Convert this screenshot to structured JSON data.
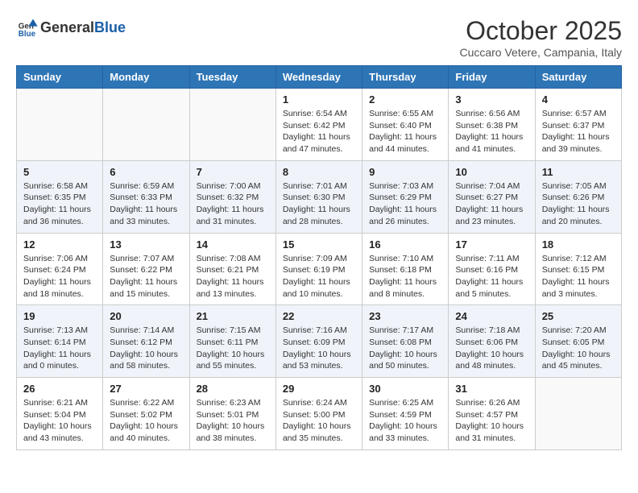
{
  "header": {
    "logo_general": "General",
    "logo_blue": "Blue",
    "month": "October 2025",
    "location": "Cuccaro Vetere, Campania, Italy"
  },
  "weekdays": [
    "Sunday",
    "Monday",
    "Tuesday",
    "Wednesday",
    "Thursday",
    "Friday",
    "Saturday"
  ],
  "weeks": [
    [
      {
        "day": "",
        "info": ""
      },
      {
        "day": "",
        "info": ""
      },
      {
        "day": "",
        "info": ""
      },
      {
        "day": "1",
        "info": "Sunrise: 6:54 AM\nSunset: 6:42 PM\nDaylight: 11 hours\nand 47 minutes."
      },
      {
        "day": "2",
        "info": "Sunrise: 6:55 AM\nSunset: 6:40 PM\nDaylight: 11 hours\nand 44 minutes."
      },
      {
        "day": "3",
        "info": "Sunrise: 6:56 AM\nSunset: 6:38 PM\nDaylight: 11 hours\nand 41 minutes."
      },
      {
        "day": "4",
        "info": "Sunrise: 6:57 AM\nSunset: 6:37 PM\nDaylight: 11 hours\nand 39 minutes."
      }
    ],
    [
      {
        "day": "5",
        "info": "Sunrise: 6:58 AM\nSunset: 6:35 PM\nDaylight: 11 hours\nand 36 minutes."
      },
      {
        "day": "6",
        "info": "Sunrise: 6:59 AM\nSunset: 6:33 PM\nDaylight: 11 hours\nand 33 minutes."
      },
      {
        "day": "7",
        "info": "Sunrise: 7:00 AM\nSunset: 6:32 PM\nDaylight: 11 hours\nand 31 minutes."
      },
      {
        "day": "8",
        "info": "Sunrise: 7:01 AM\nSunset: 6:30 PM\nDaylight: 11 hours\nand 28 minutes."
      },
      {
        "day": "9",
        "info": "Sunrise: 7:03 AM\nSunset: 6:29 PM\nDaylight: 11 hours\nand 26 minutes."
      },
      {
        "day": "10",
        "info": "Sunrise: 7:04 AM\nSunset: 6:27 PM\nDaylight: 11 hours\nand 23 minutes."
      },
      {
        "day": "11",
        "info": "Sunrise: 7:05 AM\nSunset: 6:26 PM\nDaylight: 11 hours\nand 20 minutes."
      }
    ],
    [
      {
        "day": "12",
        "info": "Sunrise: 7:06 AM\nSunset: 6:24 PM\nDaylight: 11 hours\nand 18 minutes."
      },
      {
        "day": "13",
        "info": "Sunrise: 7:07 AM\nSunset: 6:22 PM\nDaylight: 11 hours\nand 15 minutes."
      },
      {
        "day": "14",
        "info": "Sunrise: 7:08 AM\nSunset: 6:21 PM\nDaylight: 11 hours\nand 13 minutes."
      },
      {
        "day": "15",
        "info": "Sunrise: 7:09 AM\nSunset: 6:19 PM\nDaylight: 11 hours\nand 10 minutes."
      },
      {
        "day": "16",
        "info": "Sunrise: 7:10 AM\nSunset: 6:18 PM\nDaylight: 11 hours\nand 8 minutes."
      },
      {
        "day": "17",
        "info": "Sunrise: 7:11 AM\nSunset: 6:16 PM\nDaylight: 11 hours\nand 5 minutes."
      },
      {
        "day": "18",
        "info": "Sunrise: 7:12 AM\nSunset: 6:15 PM\nDaylight: 11 hours\nand 3 minutes."
      }
    ],
    [
      {
        "day": "19",
        "info": "Sunrise: 7:13 AM\nSunset: 6:14 PM\nDaylight: 11 hours\nand 0 minutes."
      },
      {
        "day": "20",
        "info": "Sunrise: 7:14 AM\nSunset: 6:12 PM\nDaylight: 10 hours\nand 58 minutes."
      },
      {
        "day": "21",
        "info": "Sunrise: 7:15 AM\nSunset: 6:11 PM\nDaylight: 10 hours\nand 55 minutes."
      },
      {
        "day": "22",
        "info": "Sunrise: 7:16 AM\nSunset: 6:09 PM\nDaylight: 10 hours\nand 53 minutes."
      },
      {
        "day": "23",
        "info": "Sunrise: 7:17 AM\nSunset: 6:08 PM\nDaylight: 10 hours\nand 50 minutes."
      },
      {
        "day": "24",
        "info": "Sunrise: 7:18 AM\nSunset: 6:06 PM\nDaylight: 10 hours\nand 48 minutes."
      },
      {
        "day": "25",
        "info": "Sunrise: 7:20 AM\nSunset: 6:05 PM\nDaylight: 10 hours\nand 45 minutes."
      }
    ],
    [
      {
        "day": "26",
        "info": "Sunrise: 6:21 AM\nSunset: 5:04 PM\nDaylight: 10 hours\nand 43 minutes."
      },
      {
        "day": "27",
        "info": "Sunrise: 6:22 AM\nSunset: 5:02 PM\nDaylight: 10 hours\nand 40 minutes."
      },
      {
        "day": "28",
        "info": "Sunrise: 6:23 AM\nSunset: 5:01 PM\nDaylight: 10 hours\nand 38 minutes."
      },
      {
        "day": "29",
        "info": "Sunrise: 6:24 AM\nSunset: 5:00 PM\nDaylight: 10 hours\nand 35 minutes."
      },
      {
        "day": "30",
        "info": "Sunrise: 6:25 AM\nSunset: 4:59 PM\nDaylight: 10 hours\nand 33 minutes."
      },
      {
        "day": "31",
        "info": "Sunrise: 6:26 AM\nSunset: 4:57 PM\nDaylight: 10 hours\nand 31 minutes."
      },
      {
        "day": "",
        "info": ""
      }
    ]
  ]
}
